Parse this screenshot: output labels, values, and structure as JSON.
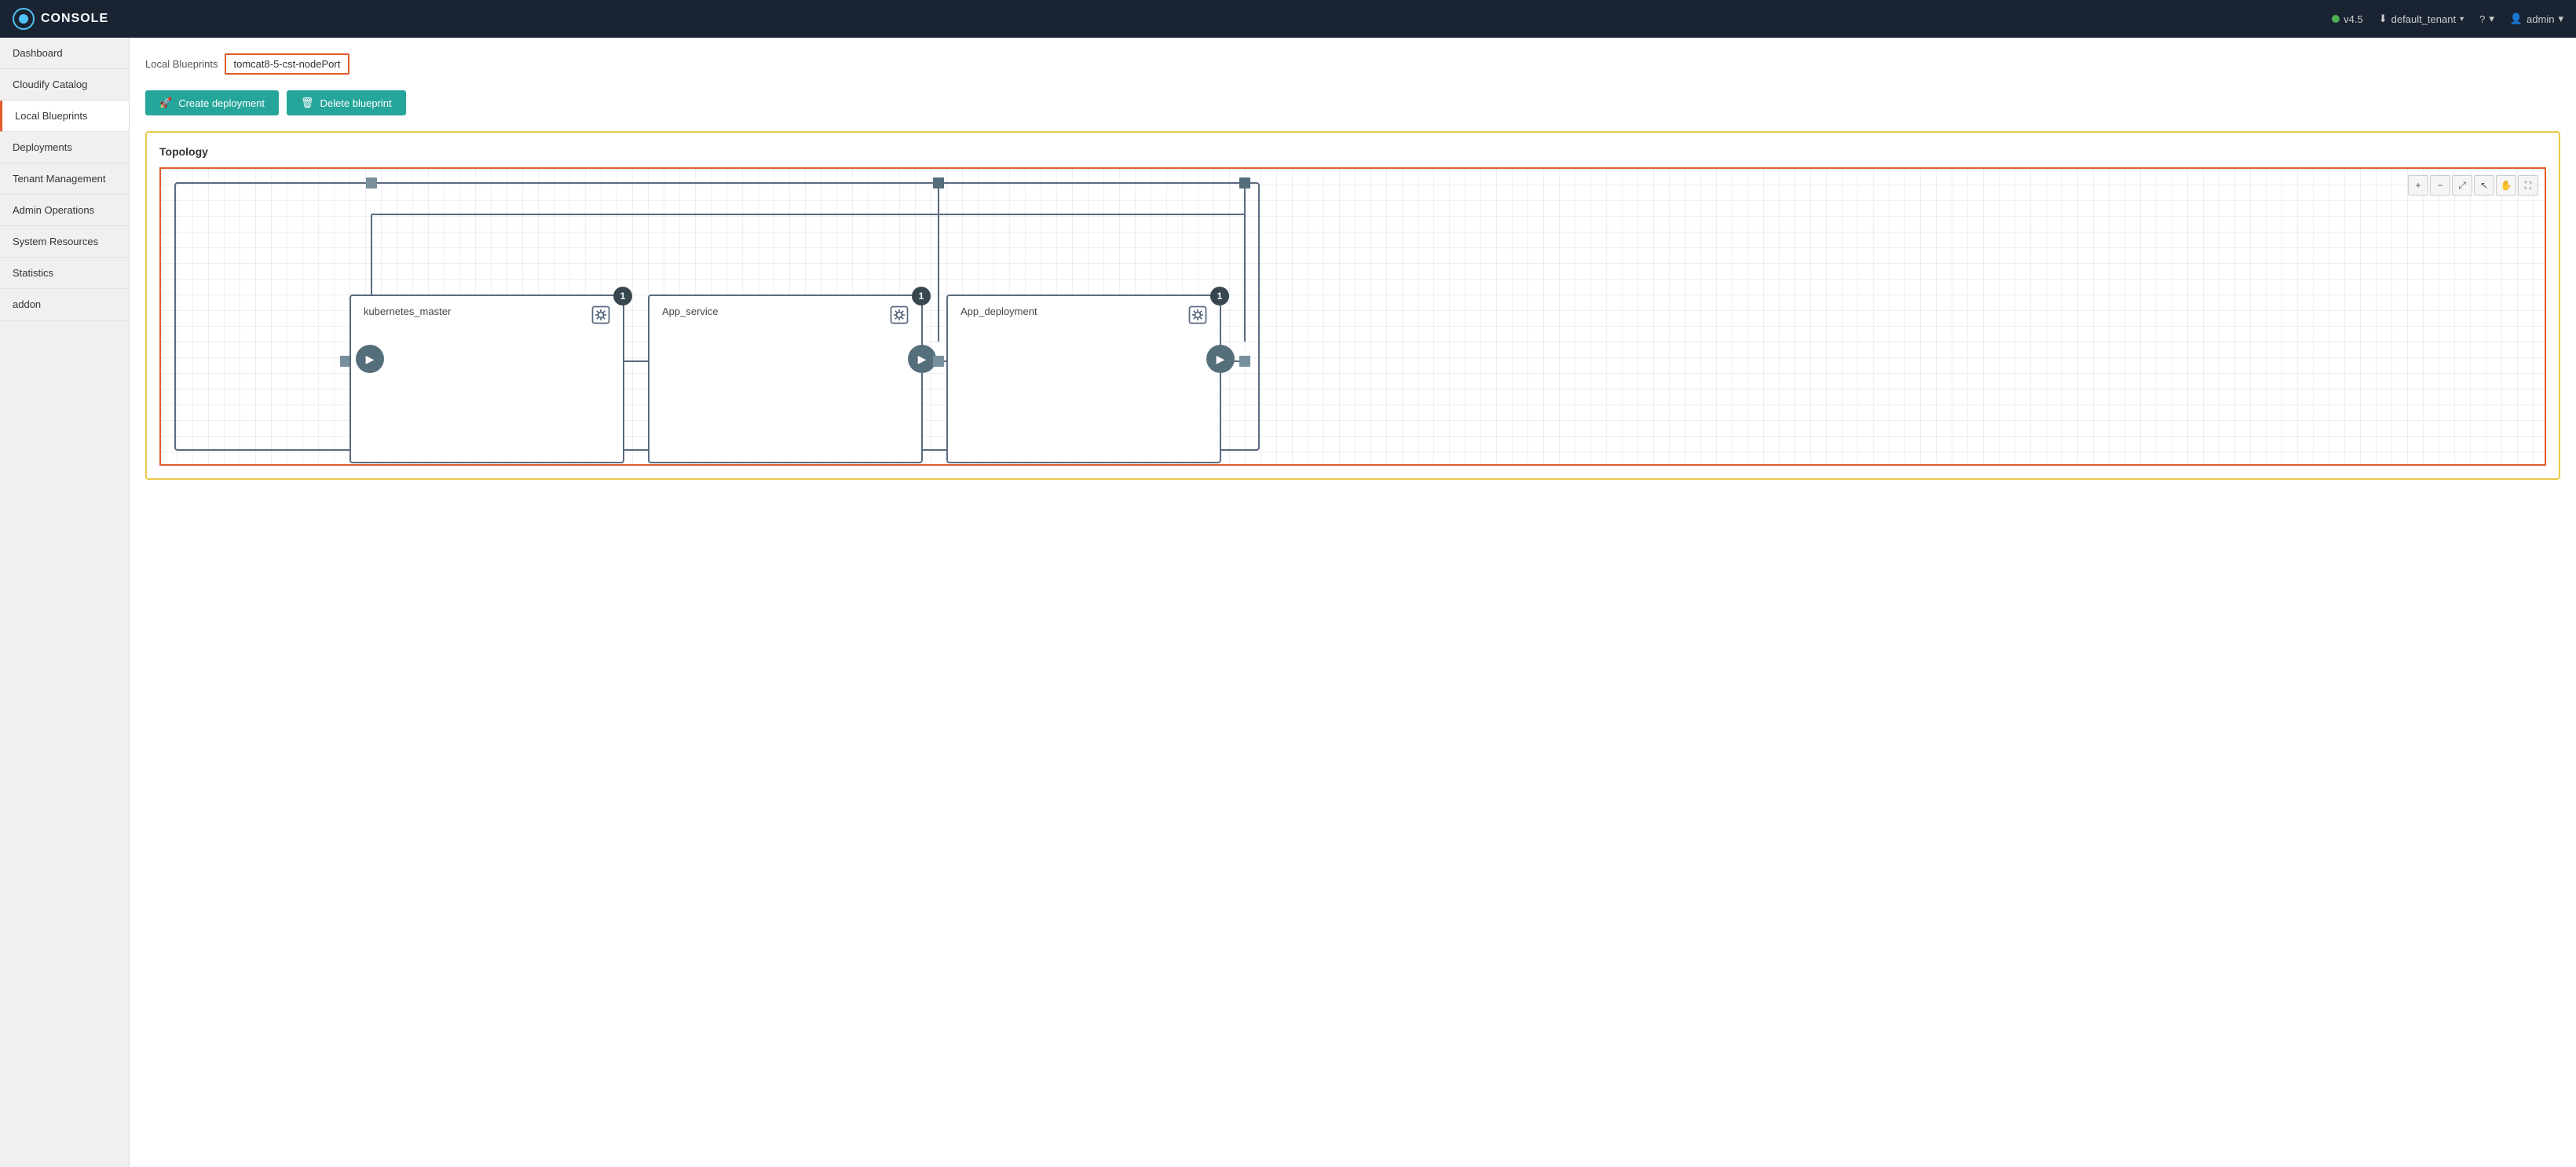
{
  "navbar": {
    "title": "CONSOLE",
    "version": "v4.5",
    "tenant": "default_tenant",
    "user": "admin",
    "help_label": "?",
    "user_icon": "👤"
  },
  "sidebar": {
    "items": [
      {
        "id": "dashboard",
        "label": "Dashboard",
        "active": false
      },
      {
        "id": "cloudify-catalog",
        "label": "Cloudify Catalog",
        "active": false
      },
      {
        "id": "local-blueprints",
        "label": "Local Blueprints",
        "active": true
      },
      {
        "id": "deployments",
        "label": "Deployments",
        "active": false
      },
      {
        "id": "tenant-management",
        "label": "Tenant Management",
        "active": false
      },
      {
        "id": "admin-operations",
        "label": "Admin Operations",
        "active": false
      },
      {
        "id": "system-resources",
        "label": "System Resources",
        "active": false
      },
      {
        "id": "statistics",
        "label": "Statistics",
        "active": false
      },
      {
        "id": "addon",
        "label": "addon",
        "active": false
      }
    ]
  },
  "breadcrumb": {
    "label": "Local Blueprints",
    "value": "tomcat8-5-cst-nodePort"
  },
  "actions": {
    "create_deployment": "Create deployment",
    "delete_blueprint": "Delete blueprint"
  },
  "topology": {
    "title": "Topology",
    "nodes": [
      {
        "id": "kubernetes_master",
        "label": "kubernetes_master",
        "badge": "1"
      },
      {
        "id": "app_service",
        "label": "App_service",
        "badge": "1"
      },
      {
        "id": "app_deployment",
        "label": "App_deployment",
        "badge": "1"
      }
    ]
  },
  "zoom_controls": [
    {
      "id": "zoom-in",
      "symbol": "+"
    },
    {
      "id": "zoom-out",
      "symbol": "−"
    },
    {
      "id": "fit",
      "symbol": "⤢"
    },
    {
      "id": "cursor",
      "symbol": "↖"
    },
    {
      "id": "pan",
      "symbol": "✋"
    },
    {
      "id": "fullscreen",
      "symbol": "⛶"
    }
  ]
}
